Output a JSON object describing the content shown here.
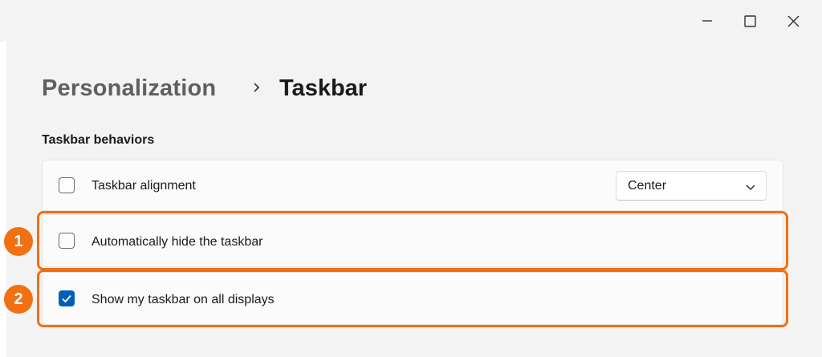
{
  "window": {
    "controls": {
      "minimize_icon": "minimize-icon",
      "maximize_icon": "maximize-icon",
      "close_icon": "close-icon"
    }
  },
  "breadcrumb": {
    "parent": "Personalization",
    "separator_icon": "chevron-right-icon",
    "current": "Taskbar"
  },
  "section": {
    "title": "Taskbar behaviors"
  },
  "settings": [
    {
      "label": "Taskbar alignment",
      "checked": false,
      "dropdown": {
        "selected": "Center",
        "icon": "chevron-down-icon"
      }
    },
    {
      "label": "Automatically hide the taskbar",
      "checked": false
    },
    {
      "label": "Show my taskbar on all displays",
      "checked": true
    }
  ],
  "annotations": {
    "callouts": [
      "1",
      "2"
    ],
    "color": "#f07012"
  },
  "colors": {
    "accent": "#005fb8",
    "highlight": "#f07012"
  }
}
